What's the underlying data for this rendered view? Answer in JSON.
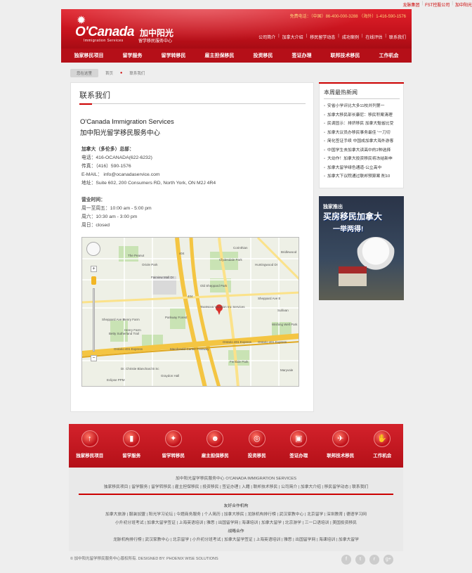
{
  "topbar": {
    "links": [
      "龙脉集团",
      "FST控股公司",
      "加中阳光"
    ]
  },
  "header": {
    "logo": "O'Canada",
    "logo_sub": "Immigration Services",
    "brand_cn": "加中阳光",
    "brand_cn2": "留学移民服务中心",
    "phones": "免费电话：（中国）86-400-000-3288  （海外）1-416-590-1576",
    "subnav": [
      "公司简介",
      "加拿大介绍",
      "移民留学动态",
      "成功案例",
      "在线评估",
      "联系我们"
    ]
  },
  "mainnav": [
    "独家移民项目",
    "留学服务",
    "留学转移民",
    "雇主担保移民",
    "投资移民",
    "签证办理",
    "联邦技术移民",
    "工作机会"
  ],
  "breadcrumb": {
    "here": "您在这里",
    "home": "首页",
    "current": "联系我们"
  },
  "contact": {
    "title": "联系我们",
    "company_en": "O'Canada Immigration Services",
    "company_cn": "加中阳光留学移民服务中心",
    "hq_label": "加拿大（多伦多）总部：",
    "phone": "电话：416-OCANADA(622-6232)",
    "fax": "传真：（416）590-1576",
    "email": "E-MAIL： info@ocanadaservice.com",
    "address": "地址：Suite 602, 200 Consumers RD, North York, ON M2J 4R4",
    "hours_label": "营业时间：",
    "hours": [
      "周一至周五：10:00 am - 5:00 pm",
      "周六：10:30 am - 3:00 pm",
      "周日：closed"
    ]
  },
  "map": {
    "labels": {
      "peanut": "The Peanut",
      "oriole": "Oriole Park",
      "corinthian": "Corinthian",
      "bridlewood": "Bridlewood",
      "clydesdale": "Clydesdale Park",
      "huntingwood": "Huntingwood Dr",
      "fairview": "Fairview Mall Dr",
      "oldsheppard": "Old Sheppard Park",
      "sheppard_w": "Sheppard Ave E",
      "sheppard_e": "Sheppard Ave E",
      "taranova": "TaraNova Vacation Inc Services",
      "sullivan": "Sullivan",
      "wishing": "Wishing Well Park",
      "henry1": "Henry Farm",
      "henry2": "Henry Farm",
      "parkway": "Parkway Forest",
      "betty": "Betty Sutherland Trail",
      "ontario": "Ontario 401 Express",
      "macdonald": "Macdonald-Cartier Freeway",
      "ontario2": "Ontario 401 Express",
      "ontario3": "Ontario 401 Express",
      "dr": "Dr. Christie Blanchard B Sc",
      "graydon": "Graydon Hall",
      "fenside": "Fenside Park",
      "maryvale": "Maryvale",
      "eclipse": "Eclipse PPM",
      "r404": "404",
      "r404b": "404"
    }
  },
  "sidebar": {
    "title": "本周最热新闻",
    "news": [
      "安省小学评比大多11校并列第一",
      "加拿大移民部长康尼：移民积案清理",
      "民调显示：排挤移民 加拿大魁省比受",
      "加拿大议员办移民事务最佳  '一刀切",
      "简化签证手续 中国成加拿大海外游客",
      "中国学生去加拿大读高中的2种选择",
      "大幼作！加拿大投资移民将冻结新申",
      "加拿大留学绿色通道-公立高中",
      "加拿大下议院通过联邦预算案 削10"
    ],
    "ad_line1": "独家推出",
    "ad_line2": "买房移民加拿大",
    "ad_line3": "一举两得!"
  },
  "footer": {
    "icons": [
      {
        "label": "独家移民项目",
        "glyph": "↑"
      },
      {
        "label": "留学服务",
        "glyph": "▮"
      },
      {
        "label": "留学转移民",
        "glyph": "✦"
      },
      {
        "label": "雇主担保移民",
        "glyph": "☻"
      },
      {
        "label": "投资移民",
        "glyph": "◎"
      },
      {
        "label": "签证办理",
        "glyph": "▣"
      },
      {
        "label": "联邦技术移民",
        "glyph": "✈"
      },
      {
        "label": "工作机会",
        "glyph": "✋"
      }
    ],
    "company": "加中阳光留学移民服务中心   O'CANADA IMMIGRATION SERVICES",
    "links1": "独家移民项目 | 留学服务 | 留学转移民 | 雇主担保移民 | 投资移民 | 签证办理 | 入籍 | 联邦技术移民 | 公司简介 | 加拿大介绍 | 移民留学动态 | 联系我们",
    "partners_label": "友好合作机构",
    "links2": "加拿大旅游 | 服装加盟 | 阳光学习论坛 | 今题商务服务 | 个人简历 | 加拿大移民 | 龙脉机构排行榜 | 武汉家教中心 | 北京留学 | 深圳教育 | 德语学习网",
    "links3": "小升初分班考试 | 加拿大留学签证 | 上海英语培训 | 雅思 | 出国留学网 | 海课培训 | 加拿大留学 | 北京游学 | 三一口语培训 | 美国投资移民",
    "strategy_label": "战略合作",
    "links4": "龙脉机构排行榜 | 武汉家教中心 | 北京留学 | 小升初分班考试 | 加拿大留学签证 | 上海英语培训 | 雅思 | 出国留学网 | 海课培训 | 加拿大留学",
    "copyright": "© 加中阳光留学移民服务中心版权所有.       DESIGNED BY: PHOENIX WISE SOLUTIONS",
    "social": [
      "f",
      "t",
      "r",
      "g+"
    ]
  }
}
